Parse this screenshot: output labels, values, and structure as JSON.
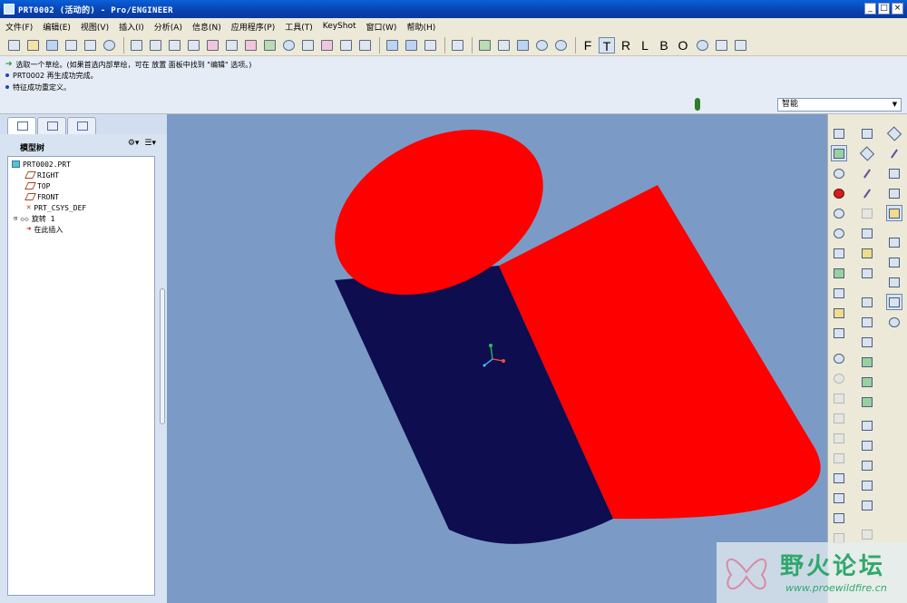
{
  "window": {
    "title": "PRT0002 (活动的) - Pro/ENGINEER",
    "min": "_",
    "max": "□",
    "close": "×"
  },
  "menu": [
    "文件(F)",
    "编辑(E)",
    "视图(V)",
    "插入(I)",
    "分析(A)",
    "信息(N)",
    "应用程序(P)",
    "工具(T)",
    "KeyShot",
    "窗口(W)",
    "帮助(H)"
  ],
  "toolbar": {
    "view_letters": [
      "F",
      "T",
      "R",
      "L",
      "B",
      "O"
    ],
    "active_letter": "T"
  },
  "messages": [
    "选取一个草绘。(如果首选内部草绘，可在 放置 面板中找到 \"编辑\" 选项。)",
    "PRT0002 再生成功完成。",
    "特征成功重定义。"
  ],
  "filter": {
    "selected": "智能"
  },
  "navigator": {
    "title": "模型树",
    "tools": [
      "⚙▾",
      "☰▾"
    ],
    "tree": [
      {
        "label": "PRT0002.PRT",
        "icon": "part-icon"
      },
      {
        "label": "RIGHT",
        "icon": "datum-plane-icon"
      },
      {
        "label": "TOP",
        "icon": "datum-plane-icon"
      },
      {
        "label": "FRONT",
        "icon": "datum-plane-icon"
      },
      {
        "label": "PRT_CSYS_DEF",
        "icon": "csys-icon"
      },
      {
        "label": "旋转 1",
        "icon": "revolve-icon"
      },
      {
        "label": "在此插入",
        "icon": "insert-here-arrow-icon"
      }
    ]
  },
  "watermark": {
    "name": "野火论坛",
    "url": "www.proewildfire.cn"
  }
}
